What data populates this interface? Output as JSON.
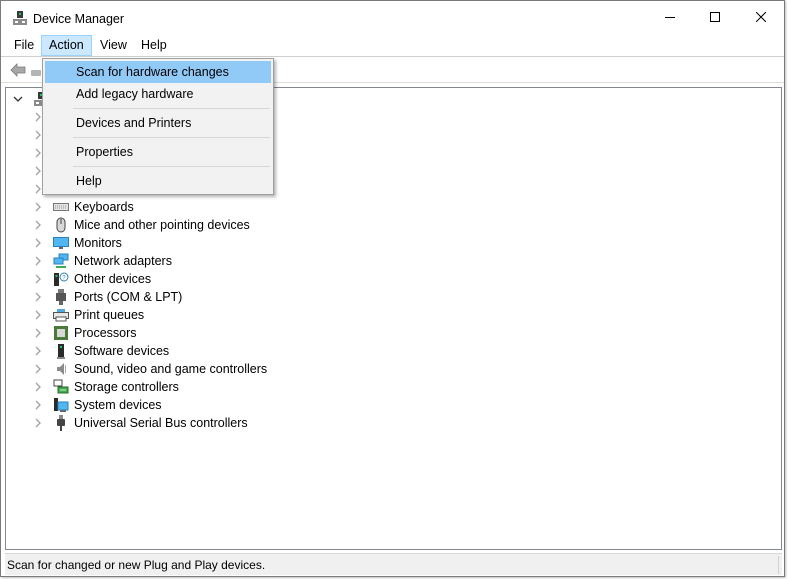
{
  "window": {
    "title": "Device Manager",
    "controls": {
      "minimize": "minimize",
      "maximize": "maximize",
      "close": "close"
    }
  },
  "menubar": {
    "items": [
      {
        "label": "File",
        "active": false
      },
      {
        "label": "Action",
        "active": true
      },
      {
        "label": "View",
        "active": false
      },
      {
        "label": "Help",
        "active": false
      }
    ]
  },
  "toolbar": {
    "icons": [
      "back-arrow-icon",
      "computer-icon"
    ]
  },
  "action_menu": {
    "items": [
      {
        "label": "Scan for hardware changes",
        "highlighted": true
      },
      {
        "label": "Add legacy hardware",
        "highlighted": false
      },
      {
        "label": "Devices and Printers",
        "highlighted": false
      },
      {
        "label": "Properties",
        "highlighted": false
      },
      {
        "label": "Help",
        "highlighted": false
      }
    ]
  },
  "tree": {
    "root": {
      "expanded": true,
      "icon": "computer-icon"
    },
    "items": [
      {
        "label": "Keyboards",
        "icon": "keyboard-icon"
      },
      {
        "label": "Mice and other pointing devices",
        "icon": "mouse-icon"
      },
      {
        "label": "Monitors",
        "icon": "monitor-icon"
      },
      {
        "label": "Network adapters",
        "icon": "network-adapter-icon"
      },
      {
        "label": "Other devices",
        "icon": "unknown-device-icon"
      },
      {
        "label": "Ports (COM & LPT)",
        "icon": "port-icon"
      },
      {
        "label": "Print queues",
        "icon": "printer-icon"
      },
      {
        "label": "Processors",
        "icon": "processor-icon"
      },
      {
        "label": "Software devices",
        "icon": "software-device-icon"
      },
      {
        "label": "Sound, video and game controllers",
        "icon": "speaker-icon"
      },
      {
        "label": "Storage controllers",
        "icon": "storage-controller-icon"
      },
      {
        "label": "System devices",
        "icon": "system-device-icon"
      },
      {
        "label": "Universal Serial Bus controllers",
        "icon": "usb-icon"
      }
    ]
  },
  "statusbar": {
    "text": "Scan for changed or new Plug and Play devices."
  },
  "colors": {
    "menu_active_bg": "#cce8ff",
    "menu_active_border": "#99d1ff",
    "dropdown_highlight": "#91c9f7",
    "dropdown_bg": "#f2f2f2",
    "statusbar_bg": "#f0f0f0"
  }
}
